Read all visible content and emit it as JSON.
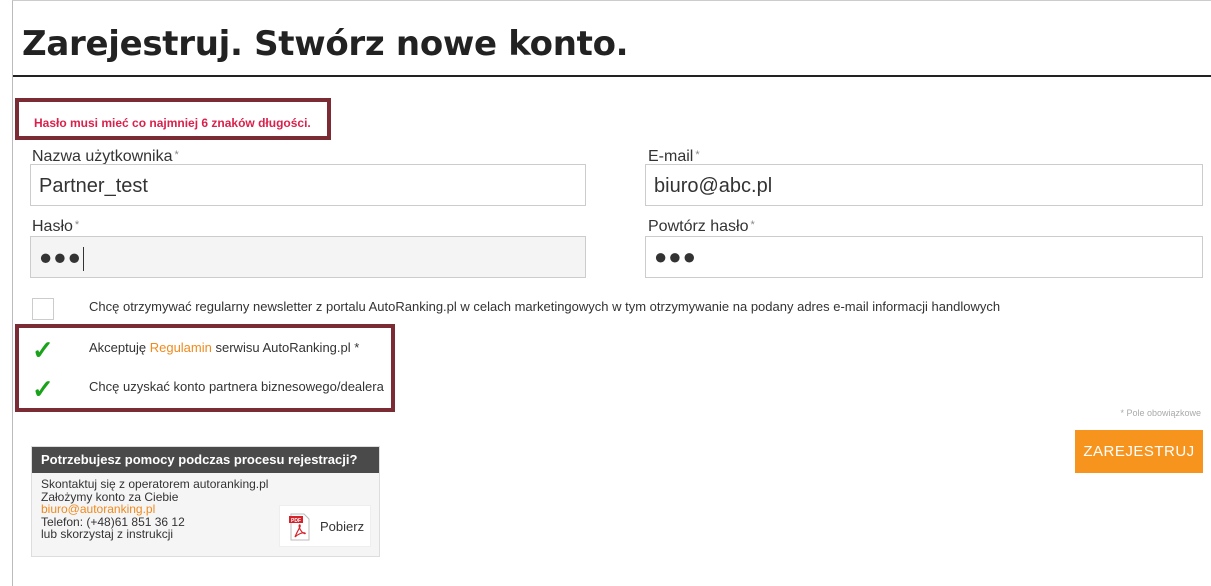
{
  "page": {
    "title": "Zarejestruj.  Stwórz nowe konto."
  },
  "error": "Hasło musi mieć co najmniej 6 znaków długości.",
  "form": {
    "username": {
      "label": "Nazwa użytkownika",
      "value": "Partner_test"
    },
    "email": {
      "label": "E-mail",
      "value": "biuro@abc.pl"
    },
    "password": {
      "label": "Hasło",
      "value": "●●●"
    },
    "password_repeat": {
      "label": "Powtórz hasło",
      "value": "●●●"
    },
    "required_mark": "*"
  },
  "checkboxes": {
    "newsletter": {
      "label": "Chcę otrzymywać regularny newsletter z portalu AutoRanking.pl w celach marketingowych w tym otrzymywanie na podany adres e-mail informacji handlowych",
      "checked": false
    },
    "terms": {
      "prefix": "Akceptuję",
      "link": "Regulamin",
      "suffix": "serwisu AutoRanking.pl *",
      "checked": true
    },
    "partner": {
      "label": "Chcę uzyskać konto partnera biznesowego/dealera",
      "checked": true
    }
  },
  "required_note": "* Pole obowiązkowe",
  "submit_label": "ZAREJESTRUJ",
  "help": {
    "header": "Potrzebujesz pomocy podczas procesu rejestracji?",
    "line1": "Skontaktuj się z operatorem autoranking.pl",
    "line2": "Założymy konto za Ciebie",
    "email": "biuro@autoranking.pl",
    "phone": "Telefon: (+48)61 851 36 12",
    "line5": "lub skorzystaj z instrukcji",
    "download_label": "Pobierz",
    "pdf_icon": "pdf-file-icon"
  },
  "colors": {
    "accent": "#f7941d",
    "error": "#d9214b",
    "highlight": "#7a2b34",
    "check": "#1aa31a"
  }
}
